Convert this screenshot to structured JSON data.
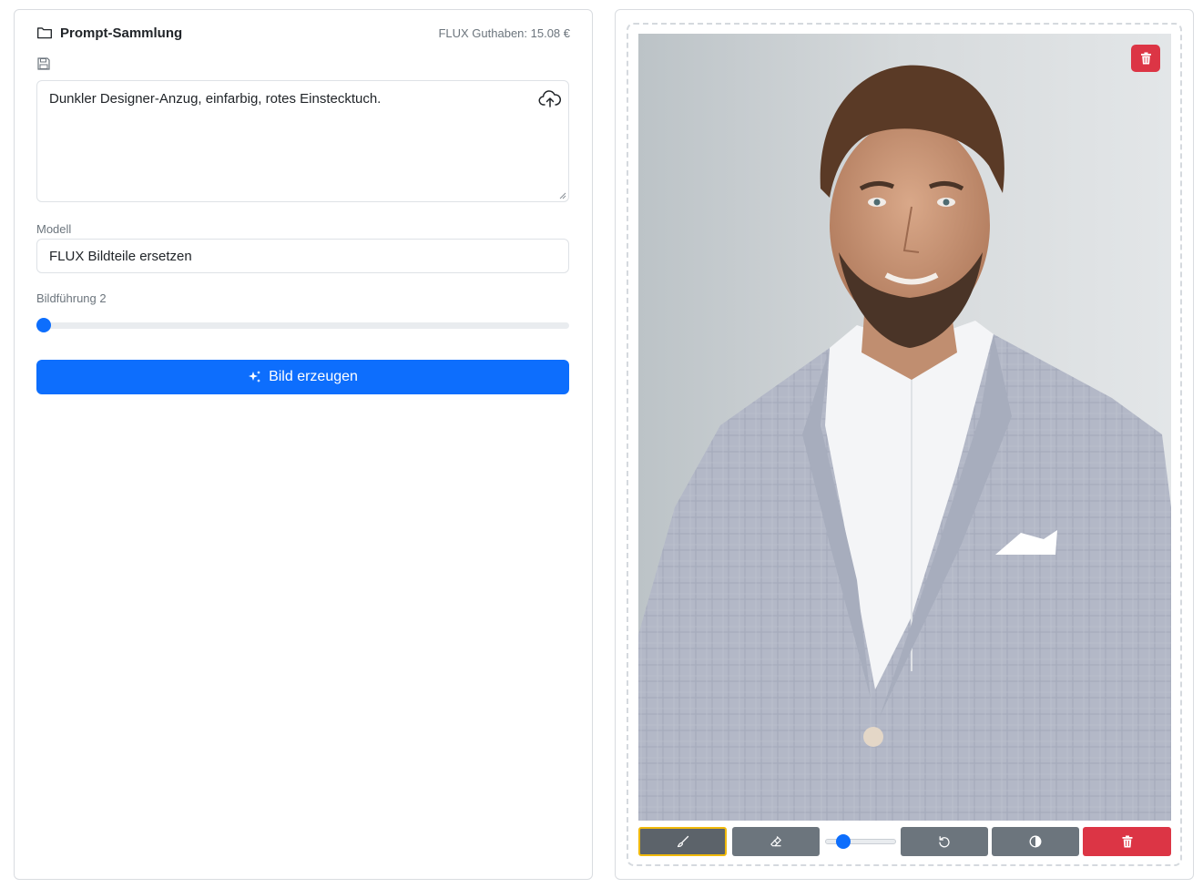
{
  "header": {
    "title": "Prompt-Sammlung",
    "credit": "FLUX Guthaben: 15.08 €",
    "folder_icon": "folder-icon",
    "save_icon": "floppy-disk-icon"
  },
  "prompt": {
    "value": "Dunkler Designer-Anzug, einfarbig, rotes Einstecktuch.",
    "upload_icon": "cloud-upload-icon"
  },
  "model": {
    "label": "Modell",
    "value": "FLUX Bildteile ersetzen"
  },
  "guidance": {
    "label": "Bildführung 2",
    "level": 0
  },
  "generate_button": {
    "label": "Bild erzeugen",
    "icon": "sparkles-icon",
    "color": "#0d6efd"
  },
  "canvas": {
    "image_alt": "Portrait of a bearded man in a light grey checked blazer and white shirt",
    "delete_icon": "trash-icon",
    "tools": {
      "brush_icon": "brush-icon",
      "eraser_icon": "eraser-icon",
      "brush_size_level": 0.2,
      "undo_icon": "undo-icon",
      "invert_icon": "contrast-icon",
      "clear_icon": "trash-icon"
    },
    "colors": {
      "active_outline": "#f0b90b",
      "danger": "#dc3545",
      "tool": "#6c757d"
    }
  }
}
